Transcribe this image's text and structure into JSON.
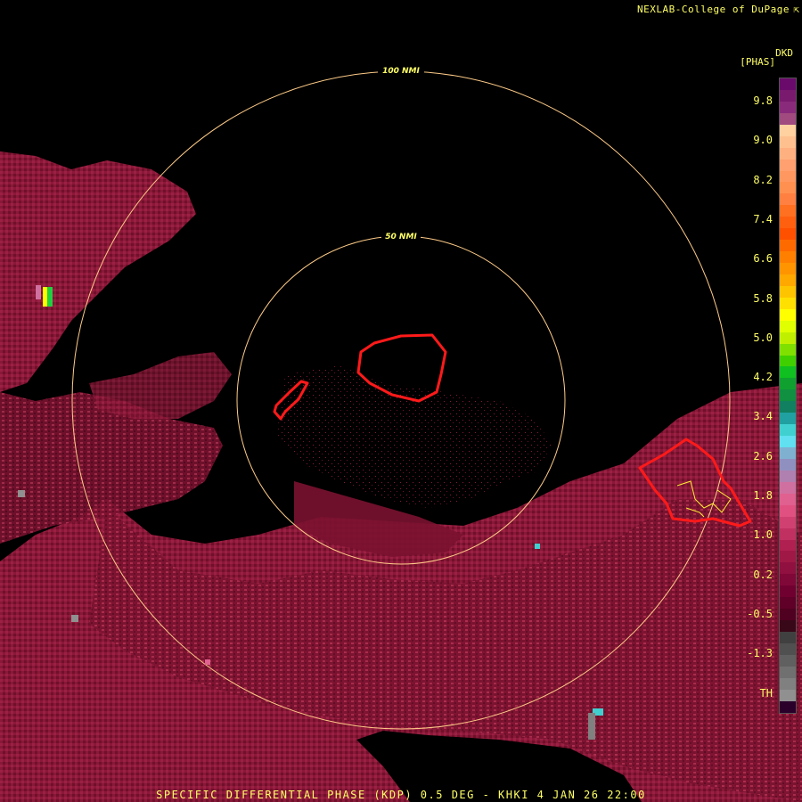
{
  "credit": "NEXLAB-College of DuPage",
  "credit_icon": "external-link-icon",
  "product_code": "DKD",
  "product_units": "[PHAS]",
  "footer": "SPECIFIC DIFFERENTIAL PHASE (KDP) 0.5 DEG - KHKI 4 JAN 26 22:00",
  "range_rings": [
    "50 NMI",
    "100 NMI"
  ],
  "legend": {
    "labels": [
      "9.8",
      "9.0",
      "8.2",
      "7.4",
      "6.6",
      "5.8",
      "5.0",
      "4.2",
      "3.4",
      "2.6",
      "1.8",
      "1.0",
      "0.2",
      "-0.5",
      "-1.3",
      "TH"
    ],
    "colors": [
      "#6a0a6a",
      "#7a1a6e",
      "#8a2a7a",
      "#a04a80",
      "#ffd0a0",
      "#ffc090",
      "#ffb080",
      "#ffa070",
      "#ff9860",
      "#ff9050",
      "#ff8040",
      "#ff7020",
      "#ff6010",
      "#ff5000",
      "#ff6a00",
      "#ff8000",
      "#ff9400",
      "#ffa800",
      "#ffc400",
      "#ffe000",
      "#ffff00",
      "#e0ff00",
      "#c0f000",
      "#80e000",
      "#40d000",
      "#10c020",
      "#10a030",
      "#109040",
      "#108060",
      "#20a0a0",
      "#40d0d0",
      "#60e0f0",
      "#80b0d0",
      "#9090c0",
      "#b080b0",
      "#d070a0",
      "#e06090",
      "#e05080",
      "#d04070",
      "#c03060",
      "#b02050",
      "#a01845",
      "#901040",
      "#800838",
      "#700030",
      "#600028",
      "#500020",
      "#380818",
      "#404040",
      "#505050",
      "#606060",
      "#707070",
      "#808080",
      "#909090",
      "#2a002a"
    ]
  }
}
